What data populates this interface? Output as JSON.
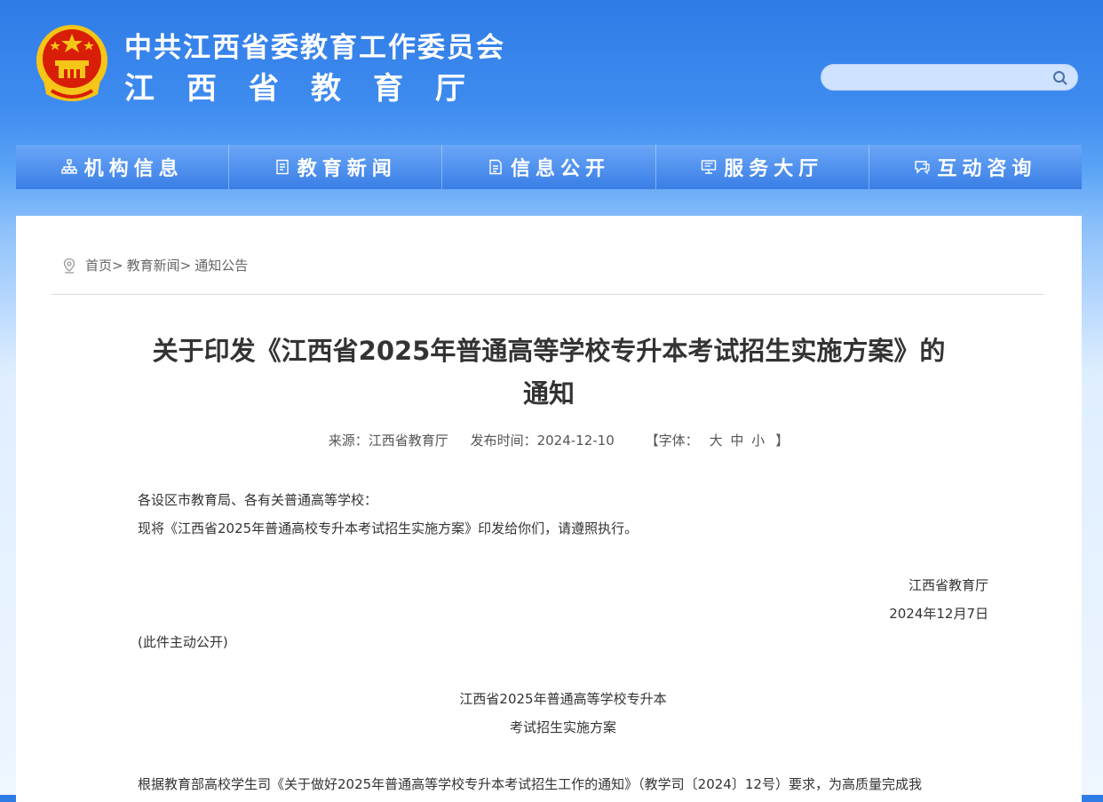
{
  "header": {
    "title_line1": "中共江西省委教育工作委员会",
    "title_line2": "江西省教育厅",
    "search_placeholder": ""
  },
  "nav": [
    {
      "label": "机构信息",
      "icon": "org-chart-icon"
    },
    {
      "label": "教育新闻",
      "icon": "news-icon"
    },
    {
      "label": "信息公开",
      "icon": "document-icon"
    },
    {
      "label": "服务大厅",
      "icon": "monitor-icon"
    },
    {
      "label": "互动咨询",
      "icon": "chat-bubble-icon"
    }
  ],
  "breadcrumb": {
    "home": "首页",
    "sep": ">",
    "level1": "教育新闻",
    "level2": "通知公告"
  },
  "article": {
    "title_line1": "关于印发《江西省2025年普通高等学校专升本考试招生实施方案》的",
    "title_line2": "通知",
    "source": "来源：江西省教育厅",
    "date": "发布时间：2024-12-10",
    "font_open": "【字体：",
    "font_large": "大",
    "font_medium": "中",
    "font_small": "小",
    "font_close": "】",
    "salutation": "各设区市教育局、各有关普通高等学校：",
    "para1": "现将《江西省2025年普通高校专升本考试招生实施方案》印发给你们，请遵照执行。",
    "signer": "江西省教育厅",
    "sign_date": "2024年12月7日",
    "public_note": "(此件主动公开)",
    "sub_title1": "江西省2025年普通高等学校专升本",
    "sub_title2": "考试招生实施方案",
    "para2": "根据教育部高校学生司《关于做好2025年普通高等学校专升本考试招生工作的通知》（教学司〔2024〕12号）要求，为高质量完成我"
  },
  "colors": {
    "header_blue": "#2f7be6",
    "nav_blue": "#3a7ee6",
    "emblem_red": "#d81e06",
    "emblem_gold": "#f5c518"
  }
}
